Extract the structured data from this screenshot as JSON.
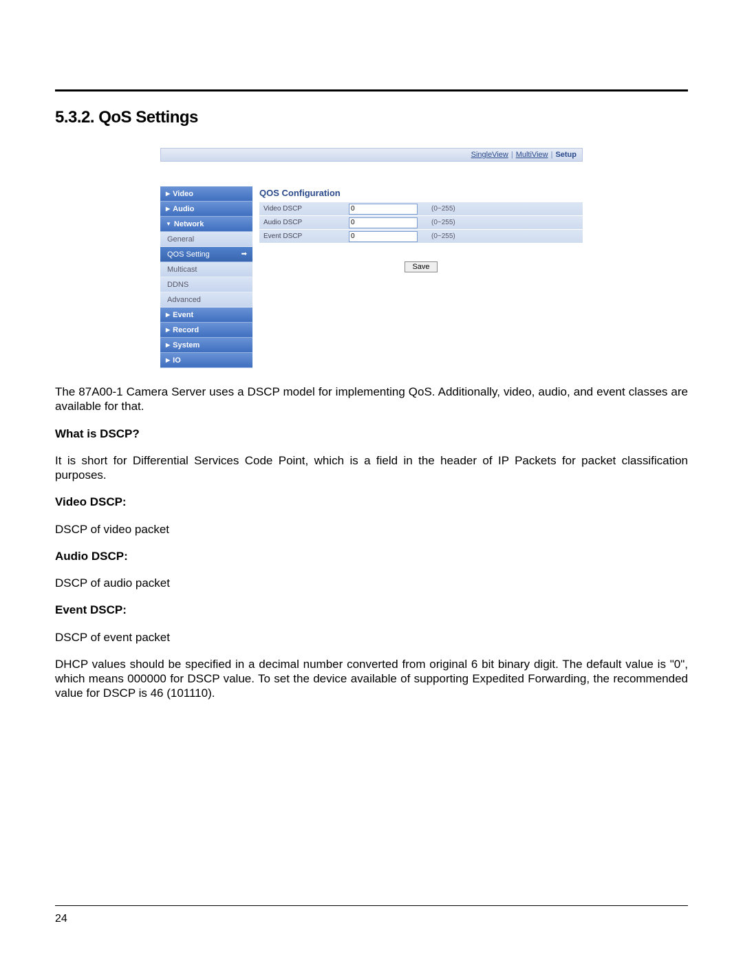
{
  "heading": "5.3.2. QoS Settings",
  "topnav": {
    "singleview": "SingleView",
    "multiview": "MultiView",
    "setup": "Setup"
  },
  "sidebar": {
    "video": "Video",
    "audio": "Audio",
    "network": "Network",
    "general": "General",
    "qos": "QOS Setting",
    "multicast": "Multicast",
    "ddns": "DDNS",
    "advanced": "Advanced",
    "event": "Event",
    "record": "Record",
    "system": "System",
    "io": "IO"
  },
  "panel": {
    "title": "QOS Configuration",
    "rows": {
      "video": {
        "label": "Video DSCP",
        "value": "0",
        "hint": "(0~255)"
      },
      "audio": {
        "label": "Audio DSCP",
        "value": "0",
        "hint": "(0~255)"
      },
      "event": {
        "label": "Event DSCP",
        "value": "0",
        "hint": "(0~255)"
      }
    },
    "save": "Save"
  },
  "text": {
    "p1": "The 87A00-1 Camera Server uses a DSCP model for implementing QoS. Additionally, video, audio, and event classes are available for that.",
    "h1": "What is DSCP?",
    "p2": "It is short for Differential Services Code Point, which is a field in the header of IP Packets for packet classification purposes.",
    "h2": "Video DSCP:",
    "p3": "DSCP of video packet",
    "h3": "Audio DSCP:",
    "p4": "DSCP of audio packet",
    "h4": "Event DSCP:",
    "p5": "DSCP of event packet",
    "p6": "DHCP values should be specified in a decimal number converted from original 6 bit binary digit.  The default value is \"0\", which means 000000 for DSCP value.  To set the device available of supporting Expedited Forwarding, the recommended value for DSCP is 46 (101110)."
  },
  "page_number": "24"
}
